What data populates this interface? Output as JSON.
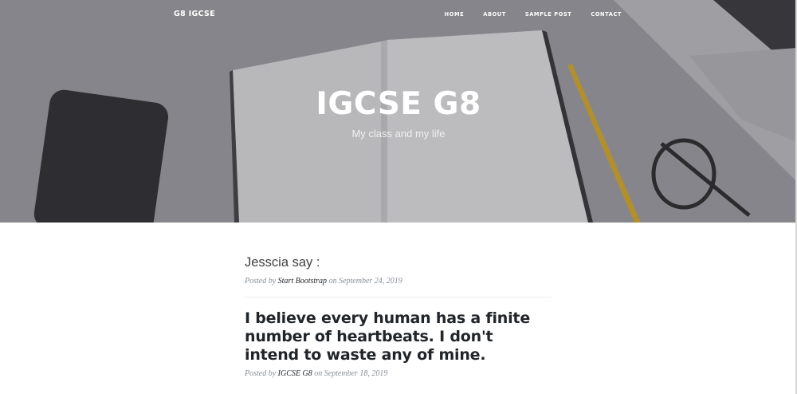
{
  "site": {
    "brand": "G8 IGCSE",
    "nav": [
      "HOME",
      "ABOUT",
      "SAMPLE POST",
      "CONTACT"
    ]
  },
  "hero": {
    "title": "IGCSE G8",
    "subtitle": "My class and my life"
  },
  "posts": [
    {
      "title": "Jesscia say :",
      "meta_prefix": "Posted by",
      "author": "Start Bootstrap",
      "meta_on": "on",
      "date": "September 24, 2019"
    },
    {
      "title": "I believe every human has a finite number of heartbeats. I don't intend to waste any of mine.",
      "meta_prefix": "Posted by",
      "author": "IGCSE G8",
      "meta_on": "on",
      "date": "September 18, 2019"
    }
  ]
}
